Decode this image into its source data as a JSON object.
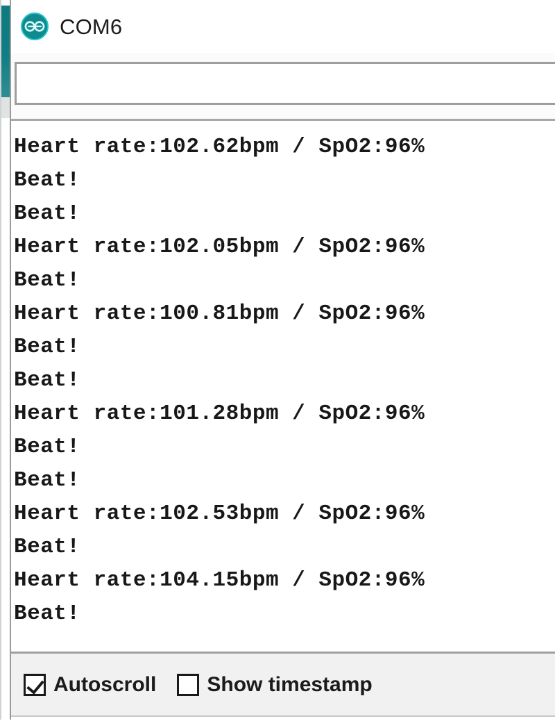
{
  "window": {
    "title": "COM6",
    "app_icon": "arduino-infinity-icon",
    "accent_color": "#0d7b80"
  },
  "send_bar": {
    "input_value": "",
    "placeholder": ""
  },
  "console": {
    "lines": [
      "Heart rate:102.62bpm / SpO2:96%",
      "Beat!",
      "Beat!",
      "Heart rate:102.05bpm / SpO2:96%",
      "Beat!",
      "Heart rate:100.81bpm / SpO2:96%",
      "Beat!",
      "Beat!",
      "Heart rate:101.28bpm / SpO2:96%",
      "Beat!",
      "Beat!",
      "Heart rate:102.53bpm / SpO2:96%",
      "Beat!",
      "Heart rate:104.15bpm / SpO2:96%",
      "Beat!"
    ],
    "readings": [
      {
        "heart_rate_bpm": 102.62,
        "spo2_percent": 96
      },
      {
        "heart_rate_bpm": 102.05,
        "spo2_percent": 96
      },
      {
        "heart_rate_bpm": 100.81,
        "spo2_percent": 96
      },
      {
        "heart_rate_bpm": 101.28,
        "spo2_percent": 96
      },
      {
        "heart_rate_bpm": 102.53,
        "spo2_percent": 96
      },
      {
        "heart_rate_bpm": 104.15,
        "spo2_percent": 96
      }
    ]
  },
  "status_bar": {
    "autoscroll": {
      "label": "Autoscroll",
      "checked": true
    },
    "show_timestamp": {
      "label": "Show timestamp",
      "checked": false
    }
  }
}
